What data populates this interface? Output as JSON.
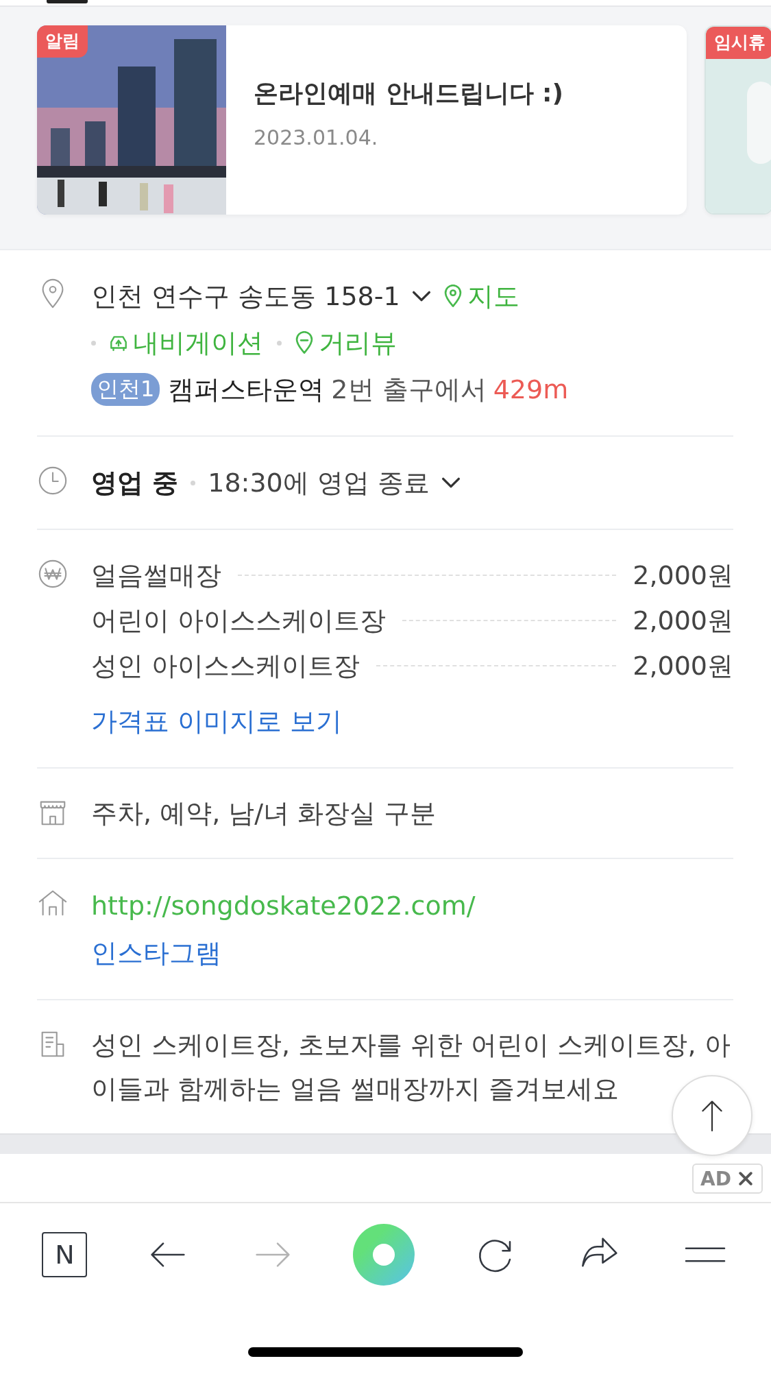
{
  "notices": [
    {
      "tag": "알림",
      "title": "온라인예매 안내드립니다 :)",
      "date": "2023.01.04.",
      "kind": "picture"
    },
    {
      "tag": "임시휴",
      "kind": "picture"
    }
  ],
  "address": {
    "text": "인천 연수구 송도동 158-1",
    "map_link": "지도",
    "links": [
      "내비게이션",
      "거리뷰"
    ],
    "subway": {
      "line": "인천1",
      "station": "캠퍼스타운역",
      "exit": "2번 출구에서",
      "distance": "429m"
    }
  },
  "hours": {
    "status": "영업 중",
    "closing": "18:30에 영업 종료"
  },
  "prices": {
    "items": [
      {
        "name": "얼음썰매장",
        "price": "2,000원"
      },
      {
        "name": "어린이 아이스스케이트장",
        "price": "2,000원"
      },
      {
        "name": "성인 아이스스케이트장",
        "price": "2,000원"
      }
    ],
    "link": "가격표 이미지로 보기"
  },
  "amenities": "주차, 예약, 남/녀 화장실 구분",
  "website": {
    "url": "http://songdoskate2022.com/",
    "instagram": "인스타그램"
  },
  "description": "성인 스케이트장, 초보자를 위한 어린이 스케이트장, 아이들과 함께하는 얼음 썰매장까지 즐겨보세요",
  "ad": {
    "label": "AD"
  },
  "toolbar": {
    "home_label": "N",
    "forward_disabled": true
  }
}
